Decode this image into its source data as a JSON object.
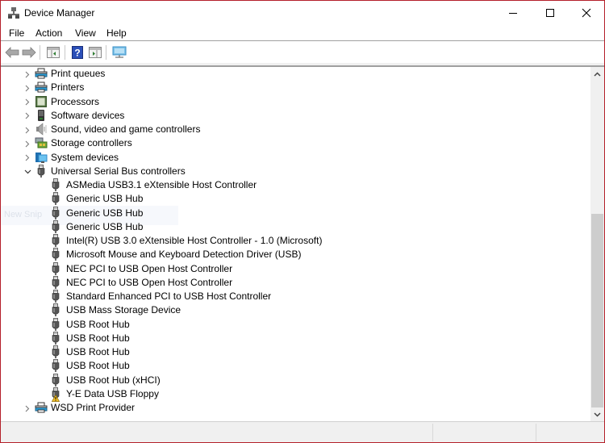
{
  "window": {
    "title": "Device Manager",
    "frame_color": "#b4202a"
  },
  "menubar": {
    "items": [
      "File",
      "Action",
      "View",
      "Help"
    ]
  },
  "toolbar": {
    "buttons": [
      "back-arrow-icon",
      "forward-arrow-icon",
      "show-hide-console-tree-icon",
      "help-icon",
      "show-action-pane-icon",
      "scan-hardware-changes-icon"
    ]
  },
  "ghost_overlay": {
    "text": "New Snip"
  },
  "tree": {
    "categories_before": [
      {
        "label": "Print queues",
        "icon": "printer-icon",
        "expanded": false
      },
      {
        "label": "Printers",
        "icon": "printer-icon",
        "expanded": false
      },
      {
        "label": "Processors",
        "icon": "processor-icon",
        "expanded": false
      },
      {
        "label": "Software devices",
        "icon": "software-device-icon",
        "expanded": false
      },
      {
        "label": "Sound, video and game controllers",
        "icon": "speaker-icon",
        "expanded": false
      },
      {
        "label": "Storage controllers",
        "icon": "storage-controller-icon",
        "expanded": false
      },
      {
        "label": "System devices",
        "icon": "system-device-icon",
        "expanded": false
      }
    ],
    "usb_category": {
      "label": "Universal Serial Bus controllers",
      "icon": "usb-plug-icon",
      "expanded": true,
      "children": [
        {
          "label": "ASMedia USB3.1 eXtensible Host Controller",
          "icon": "usb-plug-icon",
          "warning": false
        },
        {
          "label": "Generic USB Hub",
          "icon": "usb-plug-icon",
          "warning": false
        },
        {
          "label": "Generic USB Hub",
          "icon": "usb-plug-icon",
          "warning": false
        },
        {
          "label": "Generic USB Hub",
          "icon": "usb-plug-icon",
          "warning": false
        },
        {
          "label": "Intel(R) USB 3.0 eXtensible Host Controller - 1.0 (Microsoft)",
          "icon": "usb-plug-icon",
          "warning": false
        },
        {
          "label": "Microsoft Mouse and Keyboard Detection Driver (USB)",
          "icon": "usb-plug-icon",
          "warning": false
        },
        {
          "label": "NEC PCI to USB Open Host Controller",
          "icon": "usb-plug-icon",
          "warning": false
        },
        {
          "label": "NEC PCI to USB Open Host Controller",
          "icon": "usb-plug-icon",
          "warning": false
        },
        {
          "label": "Standard Enhanced PCI to USB Host Controller",
          "icon": "usb-plug-icon",
          "warning": false
        },
        {
          "label": "USB Mass Storage Device",
          "icon": "usb-plug-icon",
          "warning": false
        },
        {
          "label": "USB Root Hub",
          "icon": "usb-plug-icon",
          "warning": false
        },
        {
          "label": "USB Root Hub",
          "icon": "usb-plug-icon",
          "warning": false
        },
        {
          "label": "USB Root Hub",
          "icon": "usb-plug-icon",
          "warning": false
        },
        {
          "label": "USB Root Hub",
          "icon": "usb-plug-icon",
          "warning": false
        },
        {
          "label": "USB Root Hub (xHCI)",
          "icon": "usb-plug-icon",
          "warning": false
        },
        {
          "label": "Y-E Data USB Floppy",
          "icon": "usb-plug-icon",
          "warning": true
        }
      ]
    },
    "categories_after": [
      {
        "label": "WSD Print Provider",
        "icon": "printer-icon",
        "expanded": false
      }
    ]
  },
  "scrollbar": {
    "position_fraction": 1.0,
    "visible_fraction": 0.6
  }
}
